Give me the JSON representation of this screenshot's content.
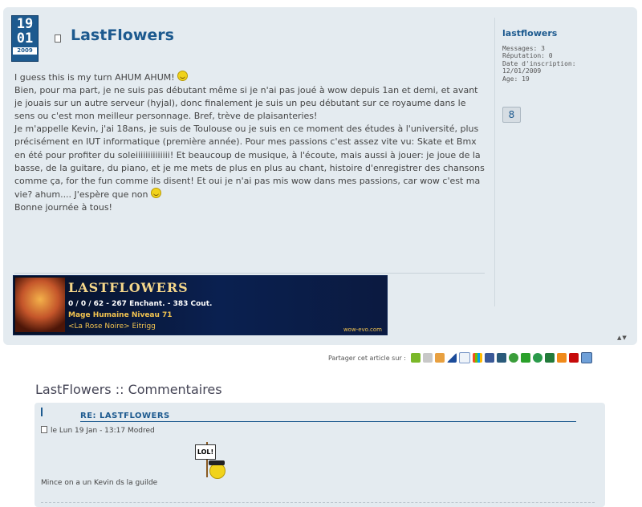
{
  "post": {
    "date": {
      "day": "19",
      "month": "01",
      "year": "2009"
    },
    "title": "LastFlowers",
    "paragraphs": [
      "I guess this is my turn AHUM AHUM! ",
      "Bien, pour ma part, je ne suis pas débutant même si je n'ai pas joué à wow depuis 1an et demi, et avant je jouais sur un autre serveur (hyjal), donc finalement je suis un peu débutant sur ce royaume dans le sens ou c'est mon meilleur personnage. Bref, trève de plaisanteries!",
      "Je m'appelle Kevin, j'ai 18ans, je suis de Toulouse ou je suis en ce moment des études à l'université, plus précisément en IUT informatique (première année). Pour mes passions c'est assez vite vu: Skate et Bmx en été pour profiter du soleiiiiiiiiiiiiii! Et beaucoup de musique, à l'écoute, mais aussi à jouer: je joue de la basse, de la guitare, du piano, et je me mets de plus en plus au chant, histoire d'enregistrer des chansons comme ça, for the fun comme ils disent! Et oui je n'ai pas mis wow dans mes passions, car wow c'est ma vie? ahum.... J'espère que non ",
      "Bonne journée à tous!"
    ],
    "signature": {
      "name": "LASTFLOWERS",
      "line1": "0 / 0 / 62 - 267 Enchant. - 383 Cout.",
      "line2": "Mage Humaine Niveau 71",
      "line3": "<La Rose Noire> Eitrigg",
      "site": "wow-evo.com"
    },
    "author": {
      "username": "lastflowers",
      "messages": "Messages: 3",
      "reputation": "Réputation: 0",
      "joined_label": "Date d'inscription:",
      "joined_date": "12/01/2009",
      "age": "Age: 19"
    },
    "updown": "▲▼"
  },
  "share": {
    "label": "Partager cet article sur :"
  },
  "comments": {
    "title": "LastFlowers :: Commentaires",
    "items": [
      {
        "re": "RE: LASTFLOWERS",
        "meta": "le Lun 19 Jan - 13:17  Modred",
        "lol": "LOL!",
        "text": "Mince on a un Kevin ds la guilde"
      }
    ]
  },
  "colors": {
    "accent": "#1d5a8f",
    "panel": "#e4ebf0"
  },
  "share_icons": [
    "digg-icon",
    "delicious-icon",
    "blogmarks-icon",
    "netvibes-icon",
    "google-icon",
    "windows-live-icon",
    "facebook-icon",
    "slashdot-icon",
    "technorati-icon",
    "myspace-icon",
    "stumbleupon-icon",
    "newsvine-icon",
    "furl-icon",
    "yahoo-icon",
    "live-icon"
  ]
}
